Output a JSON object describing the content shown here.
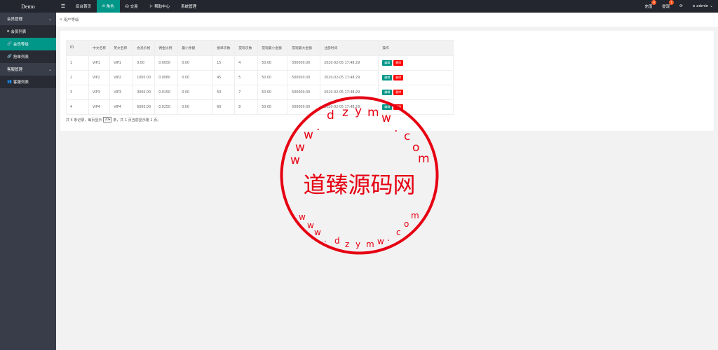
{
  "app": {
    "logo": "Demo"
  },
  "topnav": {
    "menu_icon": "menu-icon",
    "items": [
      {
        "label": "后台首页",
        "icon": ""
      },
      {
        "label": "角色",
        "icon": "user-icon",
        "active": true
      },
      {
        "label": "交易",
        "icon": "database-icon"
      },
      {
        "label": "帮助中心",
        "icon": "flag-icon"
      },
      {
        "label": "系统管理",
        "icon": ""
      }
    ],
    "right": {
      "recharge": {
        "label": "充值",
        "badge": "0"
      },
      "withdraw": {
        "label": "提现",
        "badge": "1"
      },
      "refresh_icon": "refresh-icon",
      "user": "admin"
    }
  },
  "sidebar": {
    "groups": [
      {
        "label": "会员管理",
        "items": [
          {
            "label": "会员列表",
            "icon": "user-icon"
          },
          {
            "label": "会员等级",
            "icon": "link-icon",
            "active": true
          },
          {
            "label": "抢单列表",
            "icon": "link-icon"
          }
        ]
      },
      {
        "label": "客服管理",
        "items": [
          {
            "label": "客服列表",
            "icon": "users-icon"
          }
        ]
      }
    ]
  },
  "breadcrumb": {
    "icon": "home-icon",
    "label": "用户等级"
  },
  "table": {
    "headers": [
      "ID",
      "中文名称",
      "英文名称",
      "会员价格",
      "佣金比例",
      "最小余额",
      "接单次数",
      "提现次数",
      "提现最小金额",
      "提现最大金额",
      "注册时间",
      "操作"
    ],
    "rows": [
      [
        "1",
        "VIP1",
        "VIP1",
        "0.00",
        "0.0050",
        "0.00",
        "15",
        "4",
        "50.00",
        "500000.00",
        "2020-02-05 17:48:29"
      ],
      [
        "2",
        "VIP2",
        "VIP2",
        "1000.00",
        "0.0080",
        "0.00",
        "45",
        "5",
        "50.00",
        "500000.00",
        "2020-02-05 17:48:29"
      ],
      [
        "3",
        "VIP3",
        "VIP3",
        "3000.00",
        "0.0150",
        "0.00",
        "50",
        "7",
        "50.00",
        "500000.00",
        "2020-02-05 17:48:29"
      ],
      [
        "4",
        "VIP4",
        "VIP4",
        "6000.00",
        "0.0250",
        "0.00",
        "60",
        "8",
        "50.00",
        "500000.00",
        "2020-02-05 17:48:29"
      ]
    ],
    "actions": {
      "edit": "编辑",
      "delete": "删除"
    }
  },
  "pager": {
    "prefix": "共 4 条记录，每页显示",
    "per_page": "20",
    "suffix": "条，共 1 页当前显示第 1 页。"
  },
  "watermark": {
    "center_text": "道臻源码网",
    "ring_text": "www.dzym.com",
    "color": "#e60012"
  }
}
